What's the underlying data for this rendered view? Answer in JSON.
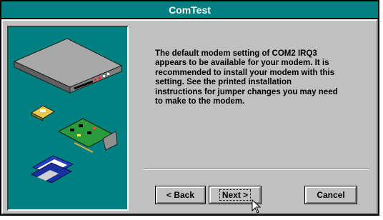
{
  "window": {
    "title": "ComTest"
  },
  "message": "The default modem setting of COM2 IRQ3\nappears to be available for your modem.  It is\nrecommended to install your modem with this\nsetting.  See the printed installation\ninstructions for jumper changes you may need\nto make to the modem.",
  "buttons": {
    "back_label": "< Back",
    "next_label": "Next >",
    "cancel_label": "Cancel"
  },
  "illustration": [
    "external-modem",
    "pc-card-modem",
    "internal-modem-card",
    "floppy-disks"
  ],
  "colors": {
    "title_bar": "#008080",
    "panel": "#008080",
    "face": "#c0c0c0"
  },
  "cursor": "arrow-cursor-icon"
}
